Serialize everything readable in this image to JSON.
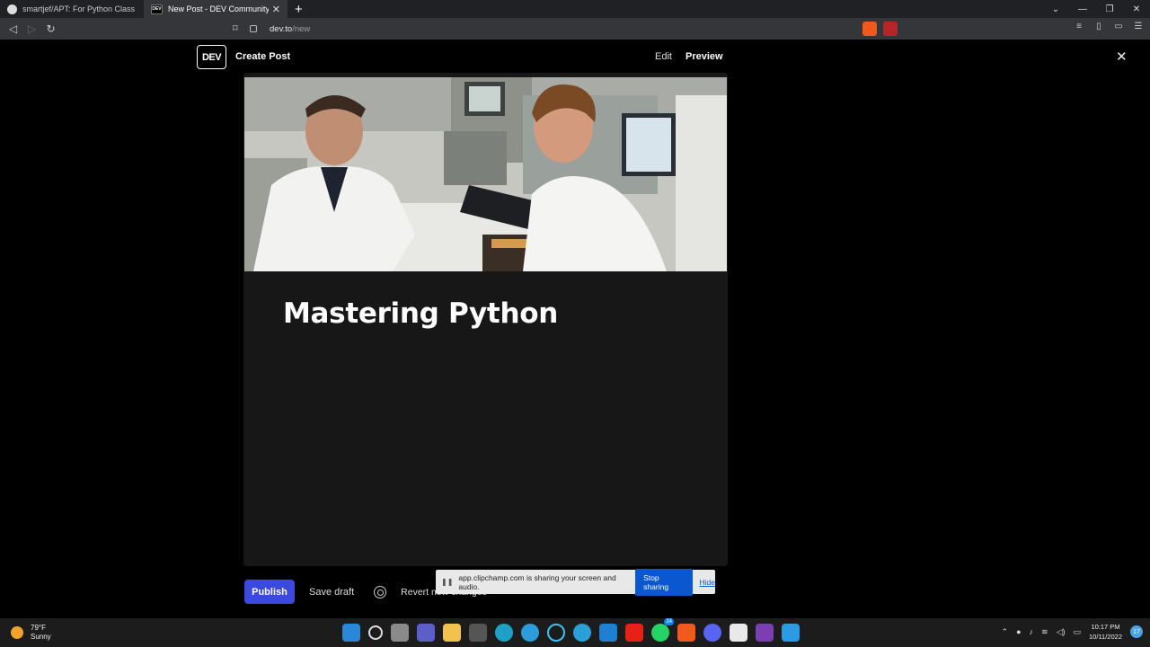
{
  "browser": {
    "tabs": [
      {
        "title": "smartjef/APT: For Python Class",
        "active": false
      },
      {
        "title": "New Post - DEV Community 🙏🙏",
        "active": true
      }
    ],
    "url_host": "dev.to",
    "url_path": "/new",
    "new_tab_label": "+"
  },
  "header": {
    "logo": "DEV",
    "page_label": "Create Post",
    "edit_label": "Edit",
    "preview_label": "Preview"
  },
  "post": {
    "title": "Mastering Python"
  },
  "actions": {
    "publish": "Publish",
    "save_draft": "Save draft",
    "revert": "Revert new changes"
  },
  "share_bar": {
    "message": "app.clipchamp.com is sharing your screen and audio.",
    "stop": "Stop sharing",
    "hide": "Hide"
  },
  "taskbar": {
    "temperature": "79°F",
    "condition": "Sunny",
    "time": "10:17 PM",
    "date": "10/11/2022",
    "whatsapp_badge": "24",
    "notification_count": "17"
  },
  "colors": {
    "publish_button": "#3b49df",
    "editor_bg": "#171717",
    "accent_blue": "#0b57d0"
  }
}
